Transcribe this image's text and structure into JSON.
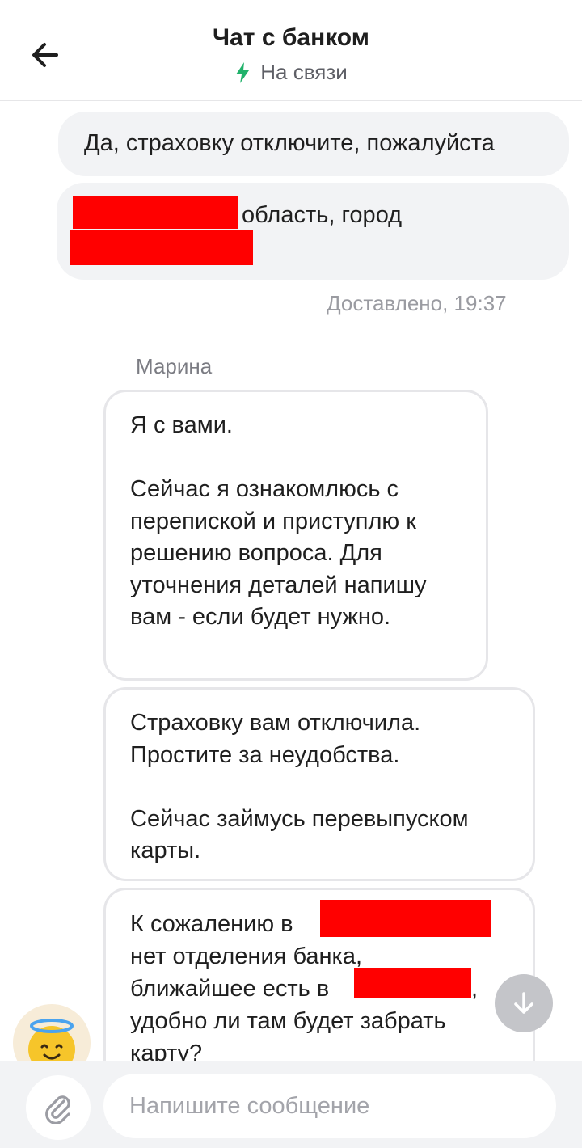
{
  "header": {
    "title": "Чат с банком",
    "status": "На связи",
    "status_icon": "lightning-icon",
    "status_color": "#21b26b"
  },
  "outgoing": [
    {
      "text": "Да, страховку отключите, пожалуйста"
    },
    {
      "text": "область, город",
      "redacted": true
    }
  ],
  "delivery_status": "Доставлено, 19:37",
  "operator": {
    "name": "Марина",
    "avatar_icon": "angel-smiley-icon"
  },
  "incoming": [
    {
      "text": "Я с вами.\n\nСейчас я ознакомлюсь с перепиской и приступлю к решению вопроса. Для уточнения деталей напишу вам - если будет нужно."
    },
    {
      "text": "Страховку вам отключила. Простите за неудобства.\n\nСейчас займусь перевыпуском карты."
    },
    {
      "part1": "К сожалению в",
      "part2": "нет отделения банка,",
      "part3": "ближайшее есть в",
      "part4": ",",
      "part5": "удобно ли там будет забрать",
      "part6": "карту?"
    }
  ],
  "composer": {
    "placeholder": "Напишите сообщение",
    "value": "",
    "attach_icon": "paperclip-icon"
  },
  "scroll_icon": "arrow-down-icon",
  "colors": {
    "redaction": "#ff0000",
    "bubble_out": "#f2f3f5",
    "bubble_in_border": "#e6e6e9"
  }
}
